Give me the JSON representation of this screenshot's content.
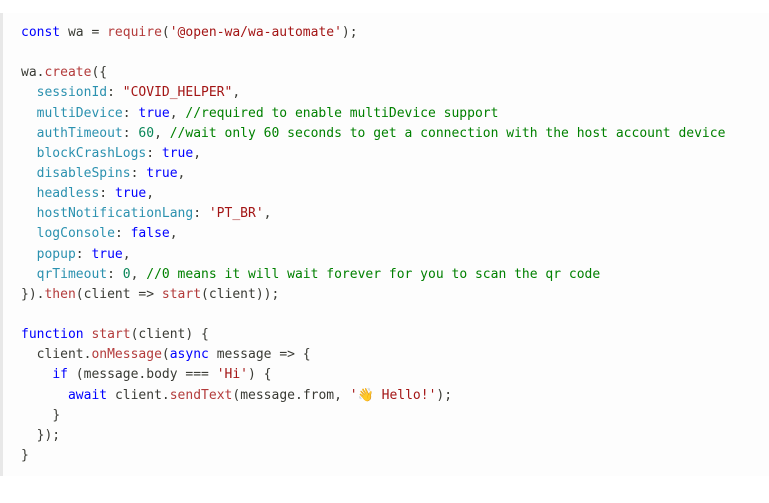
{
  "code": {
    "require_kw": "const",
    "require_var": "wa",
    "require_fn": "require",
    "require_pkg": "'@open-wa/wa-automate'",
    "create_obj": "wa",
    "create_fn": "create",
    "opts": {
      "sessionId_key": "sessionId",
      "sessionId_val": "\"COVID_HELPER\"",
      "multiDevice_key": "multiDevice",
      "multiDevice_val": "true",
      "multiDevice_cmt": "//required to enable multiDevice support",
      "authTimeout_key": "authTimeout",
      "authTimeout_val": "60",
      "authTimeout_cmt": "//wait only 60 seconds to get a connection with the host account device",
      "blockCrashLogs_key": "blockCrashLogs",
      "blockCrashLogs_val": "true",
      "disableSpins_key": "disableSpins",
      "disableSpins_val": "true",
      "headless_key": "headless",
      "headless_val": "true",
      "hostNotificationLang_key": "hostNotificationLang",
      "hostNotificationLang_val": "'PT_BR'",
      "logConsole_key": "logConsole",
      "logConsole_val": "false",
      "popup_key": "popup",
      "popup_val": "true",
      "qrTimeout_key": "qrTimeout",
      "qrTimeout_val": "0",
      "qrTimeout_cmt": "//0 means it will wait forever for you to scan the qr code"
    },
    "then_fn": "then",
    "then_param": "client",
    "then_call": "start",
    "then_arg": "client",
    "fn_kw": "function",
    "fn_name": "start",
    "fn_param": "client",
    "onMessage_obj": "client",
    "onMessage_fn": "onMessage",
    "async_kw": "async",
    "msg_param": "message",
    "if_kw": "if",
    "msg_obj": "message",
    "body_prop": "body",
    "eq_op": "===",
    "hi_str": "'Hi'",
    "await_kw": "await",
    "sendText_obj": "client",
    "sendText_fn": "sendText",
    "from_obj": "message",
    "from_prop": "from",
    "hello_str": "'👋 Hello!'"
  }
}
